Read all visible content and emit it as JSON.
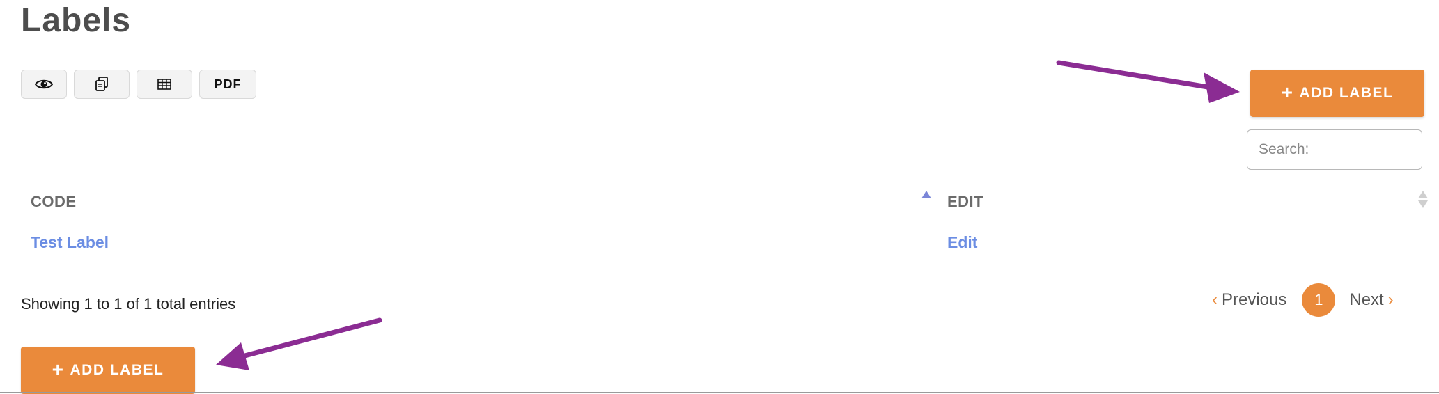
{
  "page": {
    "title": "Labels"
  },
  "toolbar": {
    "buttons": [
      {
        "name": "view",
        "icon": "eye-icon",
        "label": ""
      },
      {
        "name": "copy",
        "icon": "copy-icon",
        "label": ""
      },
      {
        "name": "csv",
        "icon": "table-icon",
        "label": ""
      },
      {
        "name": "pdf",
        "icon": "",
        "label": "PDF"
      }
    ],
    "add_label": "ADD LABEL",
    "add_icon": "plus-icon"
  },
  "search": {
    "placeholder": "Search:",
    "value": ""
  },
  "table": {
    "columns": [
      "CODE",
      "EDIT"
    ],
    "sort": {
      "column": "CODE",
      "direction": "asc"
    },
    "rows": [
      {
        "code": "Test Label",
        "edit": "Edit"
      }
    ]
  },
  "info": {
    "text": "Showing 1 to 1 of 1 total entries"
  },
  "pagination": {
    "previous": "Previous",
    "current": "1",
    "next": "Next"
  },
  "footer": {
    "add_label": "ADD LABEL"
  },
  "colors": {
    "accent": "#ea8a3b",
    "link": "#6b8de3",
    "annotation_arrow": "#8b2c93"
  }
}
